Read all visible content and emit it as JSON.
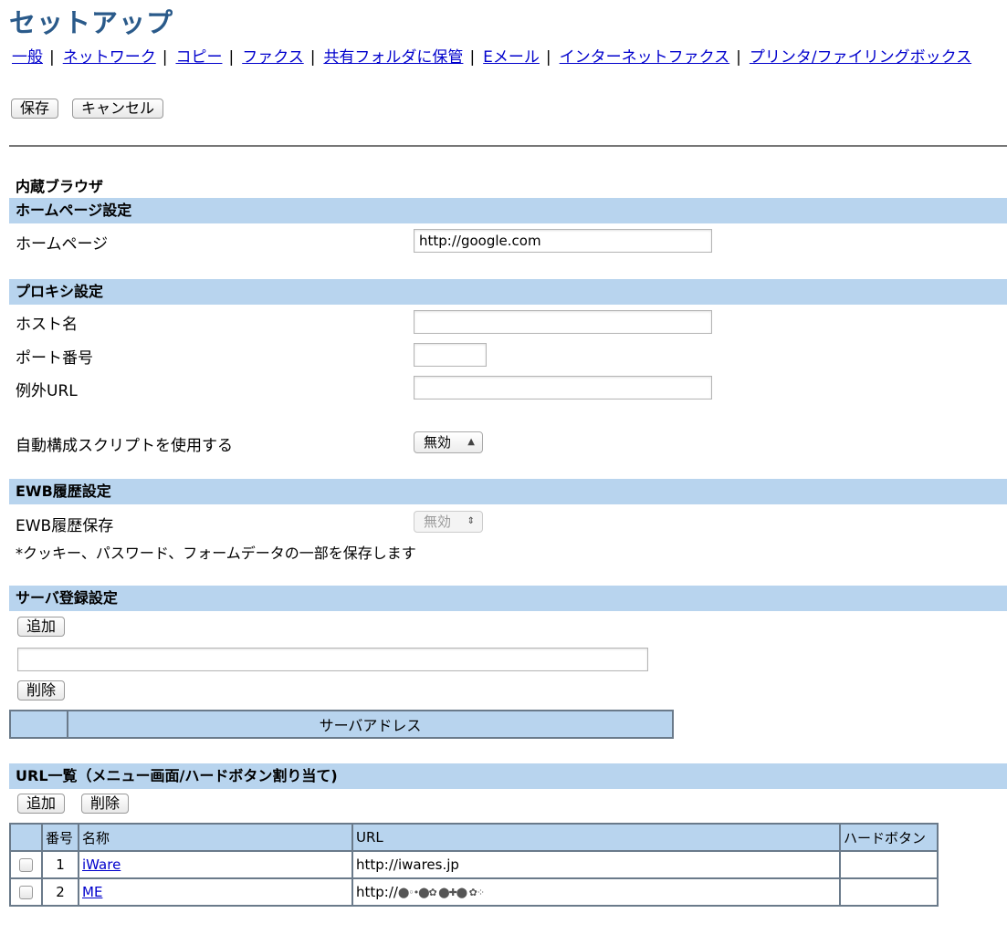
{
  "page": {
    "title": "セットアップ"
  },
  "nav": {
    "items": [
      "一般",
      "ネットワーク",
      "コピー",
      "ファクス",
      "共有フォルダに保管",
      "Eメール",
      "インターネットファクス",
      "プリンタ/ファイリングボックス"
    ]
  },
  "actions": {
    "save_label": "保存",
    "cancel_label": "キャンセル"
  },
  "browser": {
    "heading": "内蔵ブラウザ"
  },
  "homepage_section": {
    "title": "ホームページ設定",
    "homepage_label": "ホームページ",
    "homepage_value": "http://google.com"
  },
  "proxy_section": {
    "title": "プロキシ設定",
    "host_label": "ホスト名",
    "host_value": "",
    "port_label": "ポート番号",
    "port_value": "",
    "exception_label": "例外URL",
    "exception_value": "",
    "autoconfig_label": "自動構成スクリプトを使用する",
    "autoconfig_value": "無効"
  },
  "ewb_section": {
    "title": "EWB履歴設定",
    "save_label": "EWB履歴保存",
    "save_value": "無効",
    "note": "*クッキー、パスワード、フォームデータの一部を保存します"
  },
  "server_section": {
    "title": "サーバ登録設定",
    "add_label": "追加",
    "delete_label": "削除",
    "input_value": "",
    "table_header": "サーバアドレス"
  },
  "url_section": {
    "title": "URL一覧（メニュー画面/ハードボタン割り当て)",
    "add_label": "追加",
    "delete_label": "削除",
    "columns": {
      "no": "番号",
      "name": "名称",
      "url": "URL",
      "hard_button": "ハードボタン"
    },
    "rows": [
      {
        "no": "1",
        "name": "iWare",
        "url": "http://iwares.jp",
        "hard_button": ""
      },
      {
        "no": "2",
        "name": "ME",
        "url": "http://",
        "hard_button": ""
      }
    ]
  }
}
